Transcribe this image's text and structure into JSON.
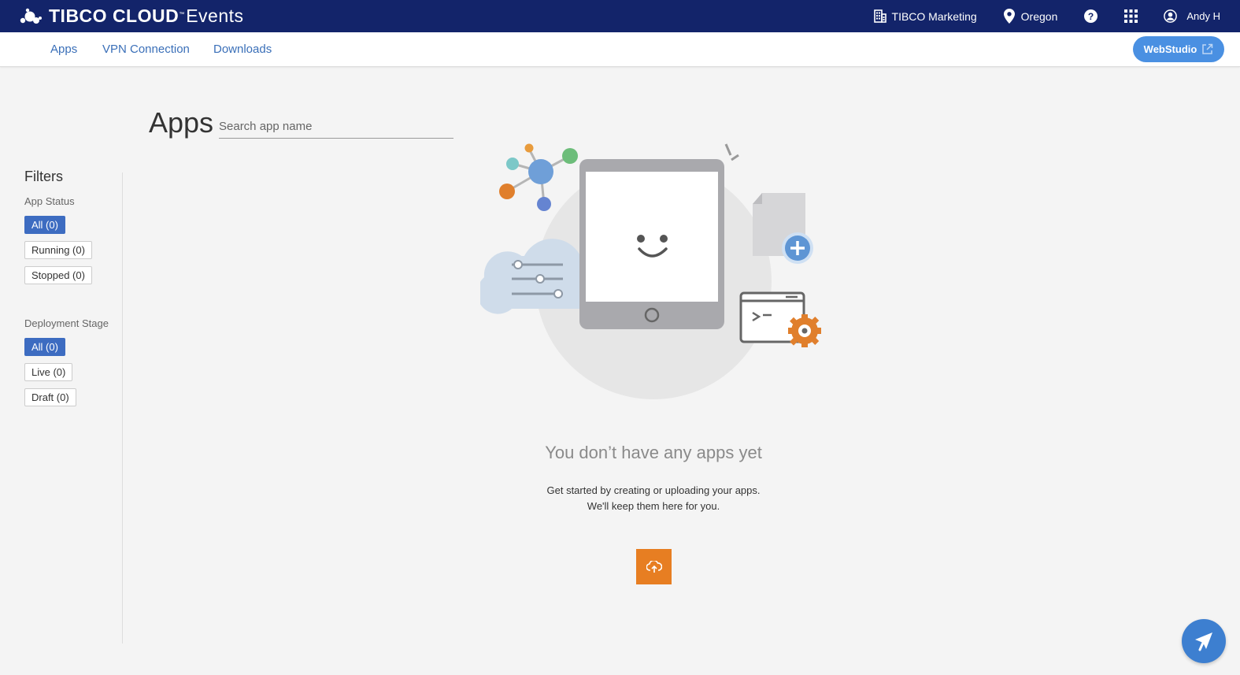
{
  "topbar": {
    "brand_main": "TIBCO CLOUD",
    "brand_tm": "™",
    "brand_product": "Events",
    "org_label": "TIBCO Marketing",
    "region_label": "Oregon",
    "user_label": "Andy H",
    "icons": [
      "building-icon",
      "location-pin-icon",
      "help-icon",
      "app-grid-icon",
      "user-avatar-icon"
    ]
  },
  "nav": {
    "links": [
      "Apps",
      "VPN Connection",
      "Downloads"
    ],
    "webstudio_label": "WebStudio"
  },
  "main": {
    "title": "Apps",
    "search_placeholder": "Search app name"
  },
  "filters": {
    "title": "Filters",
    "app_status_label": "App Status",
    "app_status_options": [
      "All (0)",
      "Running (0)",
      "Stopped (0)"
    ],
    "deployment_stage_label": "Deployment Stage",
    "deployment_stage_options": [
      "All (0)",
      "Live (0)",
      "Draft (0)"
    ]
  },
  "empty_state": {
    "title": "You don’t have any apps yet",
    "line1": "Get started by creating or uploading your apps.",
    "line2": "We'll keep them here for you."
  },
  "colors": {
    "header_bg": "#13246a",
    "link": "#3a6fb8",
    "active_chip": "#3d6cc1",
    "upload_button": "#e77e22",
    "webstudio_button": "#4a90e2",
    "feedback_button": "#3d7fd0"
  }
}
